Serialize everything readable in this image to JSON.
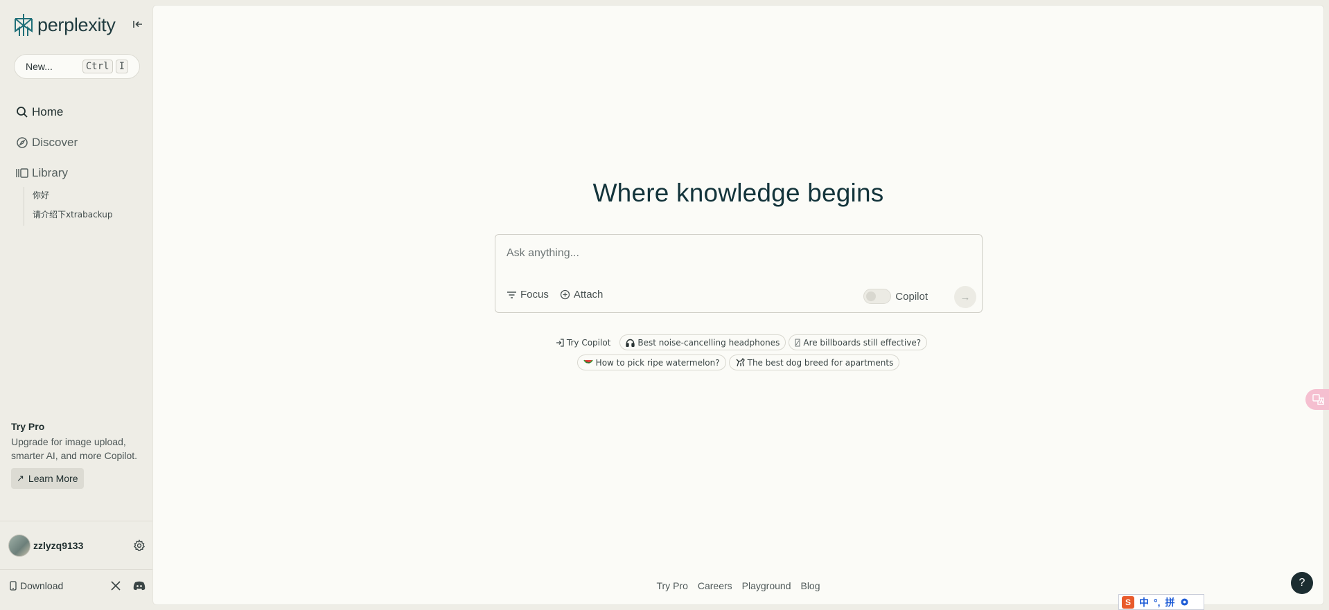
{
  "app": {
    "brand": "perplexity",
    "accent": "#1f7a8c",
    "dark": "#13343b"
  },
  "sidebar": {
    "new_label": "New...",
    "shortcut": [
      "Ctrl",
      "I"
    ],
    "nav": [
      {
        "label": "Home",
        "icon": "search-icon",
        "active": true
      },
      {
        "label": "Discover",
        "icon": "compass-icon",
        "active": false
      },
      {
        "label": "Library",
        "icon": "library-icon",
        "active": false
      }
    ],
    "library_items": [
      "你好",
      "请介绍下xtrabackup"
    ],
    "try_pro": {
      "title": "Try Pro",
      "description": "Upgrade for image upload, smarter AI, and more Copilot.",
      "button": "Learn More"
    },
    "user": {
      "name": "zzlyzq9133"
    },
    "download_label": "Download"
  },
  "main": {
    "headline": "Where knowledge begins",
    "search": {
      "placeholder": "Ask anything...",
      "focus_label": "Focus",
      "attach_label": "Attach",
      "copilot_label": "Copilot",
      "copilot_on": false
    },
    "suggestions": [
      [
        {
          "label": "Try Copilot",
          "icon": "arrow-in-icon"
        },
        {
          "label": "Best noise-cancelling headphones",
          "icon": "headphones-icon"
        },
        {
          "label": "Are billboards still effective?",
          "icon": "billboard-icon"
        }
      ],
      [
        {
          "label": "How to pick ripe watermelon?",
          "icon": "watermelon-icon"
        },
        {
          "label": "The best dog breed for apartments",
          "icon": "dog-icon"
        }
      ]
    ],
    "footer_links": [
      "Try Pro",
      "Careers",
      "Playground",
      "Blog"
    ]
  },
  "overlays": {
    "help": "?",
    "ime": [
      "中",
      "°,",
      "拼"
    ]
  }
}
